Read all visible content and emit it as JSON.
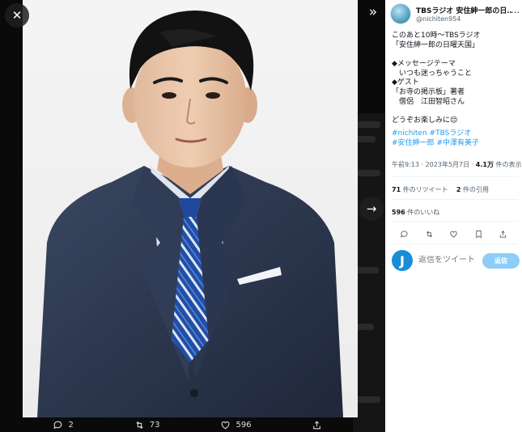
{
  "viewer": {
    "close_glyph": "✕",
    "collapse_glyph": "»",
    "next_glyph": "→",
    "actions": [
      {
        "icon": "reply-icon",
        "count": "2"
      },
      {
        "icon": "retweet-icon",
        "count": "73"
      },
      {
        "icon": "like-icon",
        "count": "596"
      },
      {
        "icon": "share-icon",
        "count": ""
      }
    ]
  },
  "tweet": {
    "author_name": "TBSラジオ 安住紳一郎の日…",
    "author_handle": "@nichiten954",
    "more_glyph": "…",
    "lines": [
      "このあと10時〜TBSラジオ",
      "「安住紳一郎の日曜天国」",
      "",
      "◆メッセージテーマ",
      "　いつも迷っちゃうこと",
      "◆ゲスト",
      "「お寺の掲示板」著者",
      "　僧侶　江田智昭さん",
      "",
      "どうぞお楽しみに😌"
    ],
    "hashtags_line1": [
      "#nichiten",
      "#TBSラジオ"
    ],
    "hashtags_line2": [
      "#安住紳一郎",
      "#中澤有美子"
    ],
    "time": "午前9:13 · 2023年5月7日 · ",
    "views_count": "4.1万",
    "views_label": " 件の表示",
    "retweets_count": "71",
    "retweets_label": " 件のリツイート",
    "quotes_count": "2",
    "quotes_label": " 件の引用",
    "likes_count": "596",
    "likes_label": " 件のいいね"
  },
  "reply": {
    "avatar_letter": "J",
    "placeholder": "返信をツイート",
    "button_label": "返信"
  },
  "colors": {
    "accent": "#1d9bf0",
    "reply_button": "#8ecdf8"
  }
}
